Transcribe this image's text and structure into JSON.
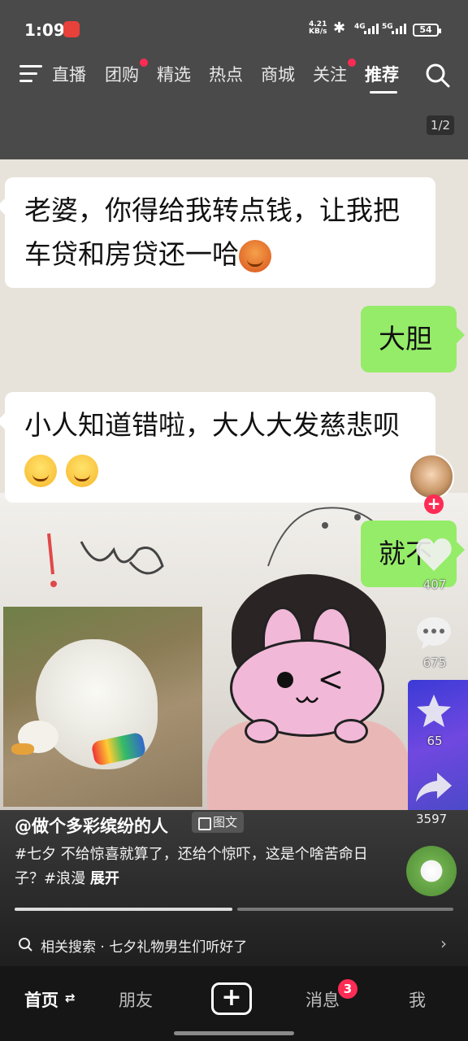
{
  "status_bar": {
    "time": "1:09",
    "net_speed_value": "4.21",
    "net_speed_unit": "KB/s",
    "sig1": "4G",
    "sig2": "5G",
    "battery": "54"
  },
  "top_nav": {
    "tabs": [
      {
        "label": "直播"
      },
      {
        "label": "团购"
      },
      {
        "label": "精选"
      },
      {
        "label": "热点"
      },
      {
        "label": "商城"
      },
      {
        "label": "关注"
      },
      {
        "label": "推荐"
      }
    ],
    "active_tab": "推荐",
    "page_indicator": "1/2"
  },
  "chat": {
    "msg1": "老婆，你得给我转点钱，让我把车贷和房贷还一哈",
    "msg2": "大胆",
    "msg3": "小人知道错啦，大人大发慈悲呗",
    "msg4": "就不"
  },
  "rail": {
    "likes": "407",
    "comments": "675",
    "favorites": "65",
    "shares": "3597"
  },
  "caption": {
    "author": "@做个多彩缤纷的人",
    "tag": "图文",
    "text": "#七夕 不给惊喜就算了，还给个惊吓，这是个啥苦命日子？#浪漫",
    "expand": "展开",
    "related_search": "相关搜索 · 七夕礼物男生们听好了"
  },
  "bottom_nav": {
    "home": "首页",
    "friends": "朋友",
    "messages": "消息",
    "messages_badge": "3",
    "me": "我"
  },
  "colors": {
    "accent_red": "#fe2c55",
    "chat_green": "#95ec69"
  }
}
